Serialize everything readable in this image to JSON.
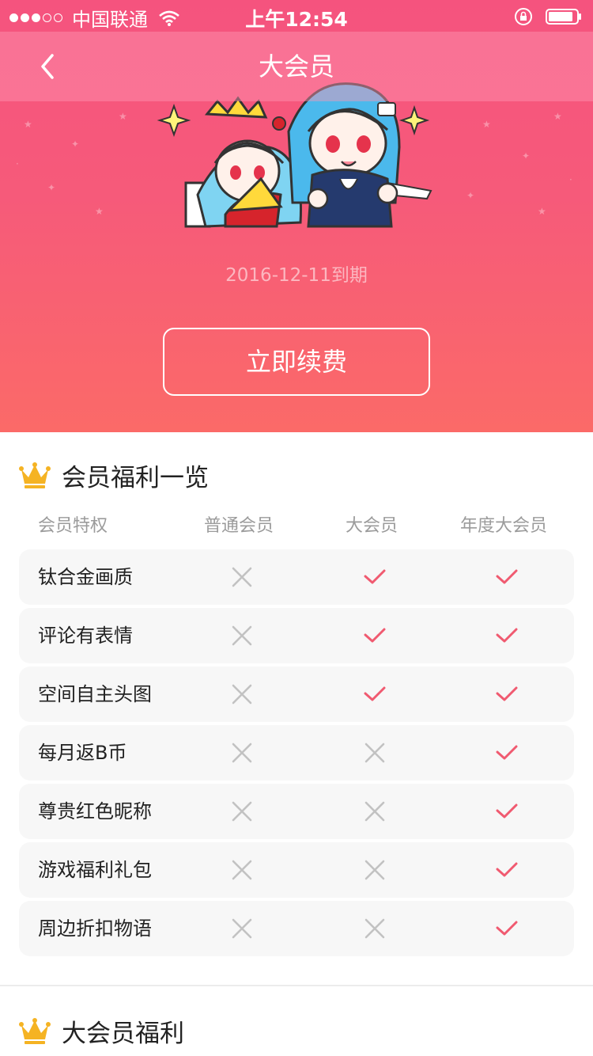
{
  "status_bar": {
    "carrier": "中国联通",
    "time": "上午12:54",
    "signal_filled": 3,
    "signal_total": 5
  },
  "nav": {
    "title": "大会员"
  },
  "membership": {
    "expire_text": "2016-12-11到期",
    "renew_label": "立即续费"
  },
  "benefits": {
    "title": "会员福利一览",
    "columns": [
      "会员特权",
      "普通会员",
      "大会员",
      "年度大会员"
    ],
    "rows": [
      {
        "label": "钛合金画质",
        "normal": false,
        "vip": true,
        "annual": true
      },
      {
        "label": "评论有表情",
        "normal": false,
        "vip": true,
        "annual": true
      },
      {
        "label": "空间自主头图",
        "normal": false,
        "vip": true,
        "annual": true
      },
      {
        "label": "每月返B币",
        "normal": false,
        "vip": false,
        "annual": true
      },
      {
        "label": "尊贵红色昵称",
        "normal": false,
        "vip": false,
        "annual": true
      },
      {
        "label": "游戏福利礼包",
        "normal": false,
        "vip": false,
        "annual": true
      },
      {
        "label": "周边折扣物语",
        "normal": false,
        "vip": false,
        "annual": true
      }
    ]
  },
  "vip_benefits": {
    "title": "大会员福利"
  },
  "colors": {
    "accent": "#f05a70",
    "cross": "#c2c2c2",
    "crown": "#f5b323"
  }
}
